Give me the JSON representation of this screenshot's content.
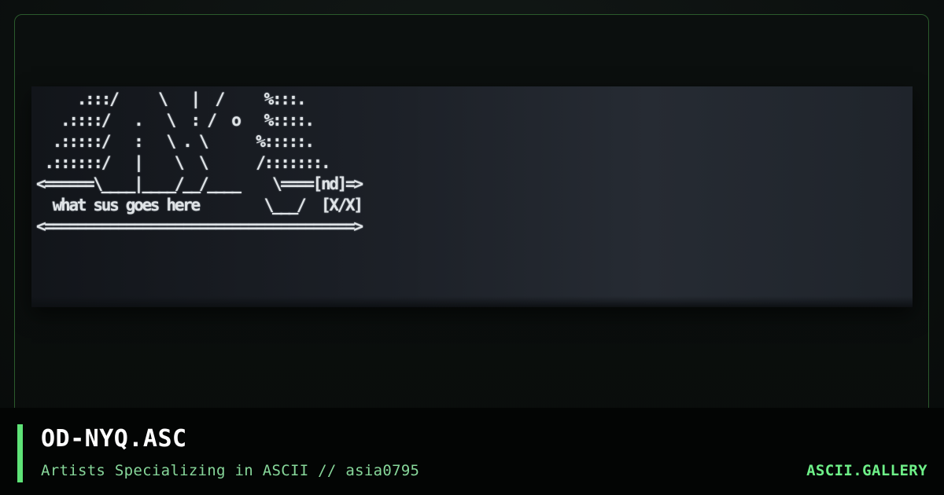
{
  "card": {
    "ascii_art": "     .:::/     \\   |  /     %:::.\n   .::::/   .   \\  : /  o   %::::.\n  .:::::/   :   \\ . \\      %:::::.\n .::::::/   |    \\  \\      /:::::::.\n<======\\____|____/__/____    \\====[nd]=>\n  what sus goes here        \\___/  [X/X]\n<======================================>"
  },
  "footer": {
    "title": "OD-NYQ.ASC",
    "subtitle": "Artists Specializing in ASCII // asia0795",
    "brand": "ASCII.GALLERY"
  },
  "colors": {
    "accent": "#5ee377",
    "border": "#2b5a2c",
    "subtitle": "#87d79a",
    "brand": "#6ef088"
  }
}
